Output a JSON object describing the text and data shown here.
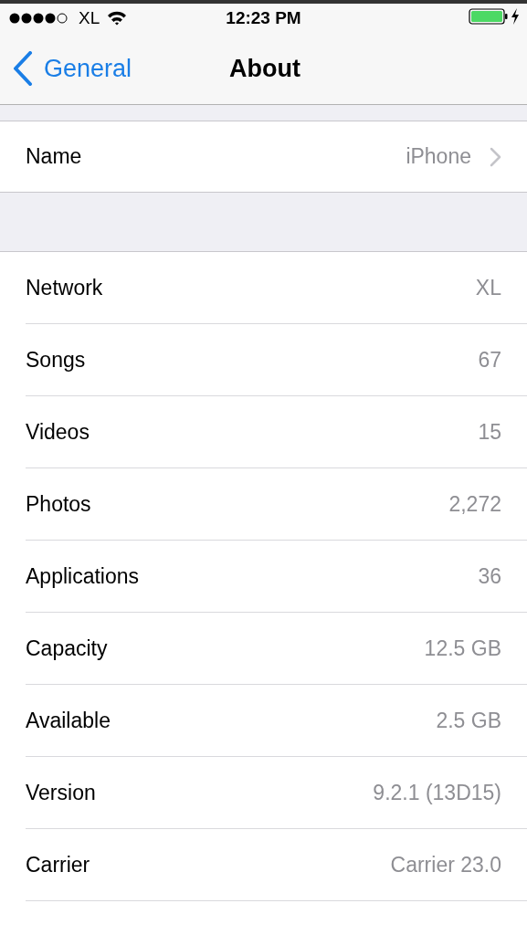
{
  "status_bar": {
    "carrier": "XL",
    "time": "12:23 PM"
  },
  "nav_bar": {
    "back": "General",
    "title": "About"
  },
  "name_row": {
    "label": "Name",
    "value": "iPhone"
  },
  "info_rows": [
    {
      "label": "Network",
      "value": "XL"
    },
    {
      "label": "Songs",
      "value": "67"
    },
    {
      "label": "Videos",
      "value": "15"
    },
    {
      "label": "Photos",
      "value": "2,272"
    },
    {
      "label": "Applications",
      "value": "36"
    },
    {
      "label": "Capacity",
      "value": "12.5 GB"
    },
    {
      "label": "Available",
      "value": "2.5 GB"
    },
    {
      "label": "Version",
      "value": "9.2.1 (13D15)"
    },
    {
      "label": "Carrier",
      "value": "Carrier 23.0"
    }
  ]
}
